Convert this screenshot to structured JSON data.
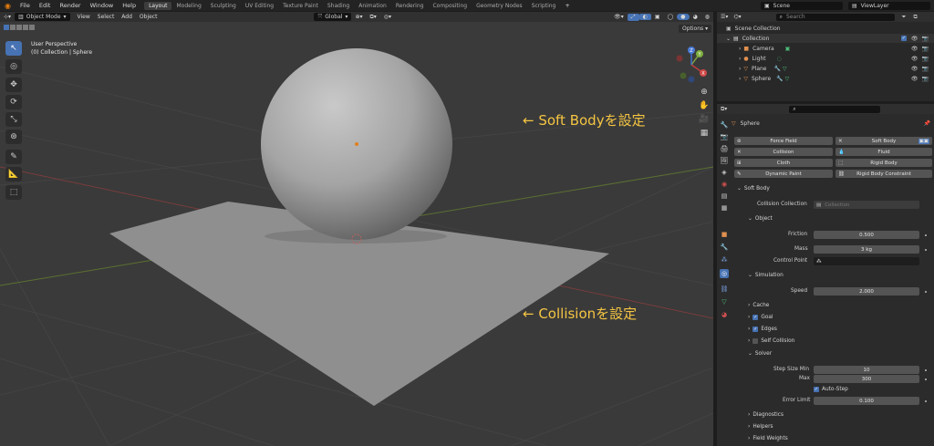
{
  "topbar": {
    "menus": [
      "File",
      "Edit",
      "Render",
      "Window",
      "Help"
    ],
    "workspaces": [
      "Layout",
      "Modeling",
      "Sculpting",
      "UV Editing",
      "Texture Paint",
      "Shading",
      "Animation",
      "Rendering",
      "Compositing",
      "Geometry Nodes",
      "Scripting"
    ],
    "active_workspace": "Layout",
    "scene": "Scene",
    "view_layer": "ViewLayer"
  },
  "viewport": {
    "mode": "Object Mode",
    "menus": [
      "View",
      "Select",
      "Add",
      "Object"
    ],
    "orientation": "Global",
    "options": "Options",
    "overlay_title": "User Perspective",
    "overlay_subtitle": "(0) Collection | Sphere",
    "gizmo": {
      "x": "X",
      "y": "Y",
      "z": "Z"
    }
  },
  "annotations": {
    "soft_body": "← Soft Bodyを設定",
    "collision": "← Collisionを設定"
  },
  "outliner": {
    "search_placeholder": "Search",
    "scene_collection": "Scene Collection",
    "collection": "Collection",
    "items": [
      {
        "name": "Camera",
        "icon": "camera-icon",
        "color": "#e09050"
      },
      {
        "name": "Light",
        "icon": "light-icon",
        "color": "#e09050"
      },
      {
        "name": "Plane",
        "icon": "mesh-icon",
        "color": "#e09050"
      },
      {
        "name": "Sphere",
        "icon": "mesh-icon",
        "color": "#e09050"
      }
    ]
  },
  "properties": {
    "search_placeholder": "",
    "object_name": "Sphere",
    "physics_buttons": [
      {
        "label": "Force Field",
        "icon": "✕"
      },
      {
        "label": "Soft Body",
        "icon": "✕"
      },
      {
        "label": "Collision",
        "icon": "✕"
      },
      {
        "label": "Fluid",
        "icon": "💧"
      },
      {
        "label": "Cloth",
        "icon": "✕"
      },
      {
        "label": "Rigid Body",
        "icon": "✕"
      },
      {
        "label": "Dynamic Paint",
        "icon": "✕"
      },
      {
        "label": "Rigid Body Constraint",
        "icon": "✕"
      }
    ],
    "soft_body_header": "Soft Body",
    "collision_collection_label": "Collision Collection",
    "collision_collection_placeholder": "Collection",
    "object_header": "Object",
    "friction_label": "Friction",
    "friction_value": "0.500",
    "mass_label": "Mass",
    "mass_value": "3 kg",
    "control_point_label": "Control Point",
    "simulation_header": "Simulation",
    "speed_label": "Speed",
    "speed_value": "2.000",
    "cache_header": "Cache",
    "goal_header": "Goal",
    "edges_header": "Edges",
    "self_collision_header": "Self Collision",
    "solver_header": "Solver",
    "step_min_label": "Step Size Min",
    "step_min_value": "10",
    "step_max_label": "Max",
    "step_max_value": "300",
    "auto_step_label": "Auto-Step",
    "error_limit_label": "Error Limit",
    "error_limit_value": "0.100",
    "diagnostics_header": "Diagnostics",
    "helpers_header": "Helpers",
    "field_weights_header": "Field Weights"
  },
  "colors": {
    "accent": "#4772b3",
    "annotation": "#f5c542",
    "active_tab": "#3d3d3d"
  }
}
